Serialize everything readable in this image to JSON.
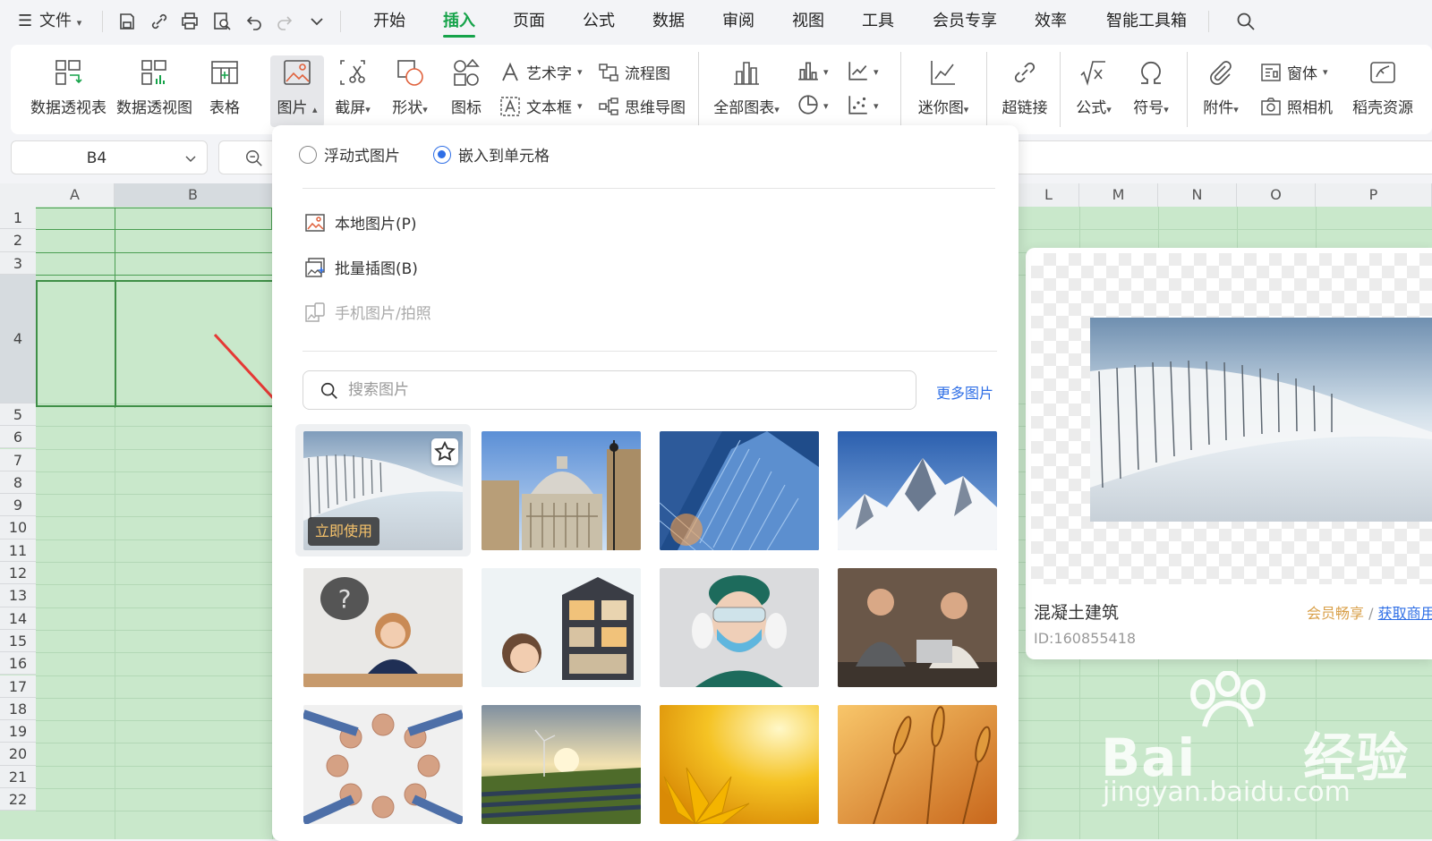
{
  "menubar": {
    "file_label": "文件",
    "tabs": [
      "开始",
      "插入",
      "页面",
      "公式",
      "数据",
      "审阅",
      "视图",
      "工具",
      "会员专享",
      "效率",
      "智能工具箱"
    ],
    "active_tab": "插入"
  },
  "ribbon": {
    "pivot_table": "数据透视表",
    "pivot_chart": "数据透视图",
    "table": "表格",
    "picture": "图片",
    "screenshot": "截屏",
    "shape": "形状",
    "icon": "图标",
    "wordart": "艺术字",
    "textbox": "文本框",
    "flowchart": "流程图",
    "mindmap": "思维导图",
    "all_charts": "全部图表",
    "sparkline": "迷你图",
    "hyperlink": "超链接",
    "formula": "公式",
    "symbol": "符号",
    "attachment": "附件",
    "form": "窗体",
    "camera": "照相机",
    "docer": "稻壳资源"
  },
  "namebox": {
    "value": "B4"
  },
  "sheet": {
    "columns_left": [
      "A",
      "B"
    ],
    "columns_right": [
      "L",
      "M",
      "N",
      "O",
      "P"
    ],
    "rows": [
      "1",
      "2",
      "3",
      "4",
      "5",
      "6",
      "7",
      "8",
      "9",
      "10",
      "11",
      "12",
      "13",
      "14",
      "15",
      "16",
      "17",
      "18",
      "19",
      "20",
      "21",
      "22"
    ]
  },
  "panel": {
    "radio_floating": "浮动式图片",
    "radio_embed": "嵌入到单元格",
    "selected_mode": "嵌入到单元格",
    "local_picture": "本地图片(P)",
    "batch_insert": "批量插图(B)",
    "phone_picture": "手机图片/拍照",
    "search_placeholder": "搜索图片",
    "more_pictures": "更多图片",
    "use_now": "立即使用"
  },
  "preview": {
    "title": "混凝土建筑",
    "id": "ID:160855418",
    "vip": "会员畅享",
    "sep": "/",
    "get": "获取商用"
  },
  "watermark": {
    "brand": "Bai",
    "suffix": "经验",
    "url": "jingyan.baidu.com"
  },
  "colors": {
    "accent": "#16a34a",
    "link": "#2f6fe6",
    "sheet_fill": "#c9e8cb",
    "vip": "#d9a04a"
  }
}
